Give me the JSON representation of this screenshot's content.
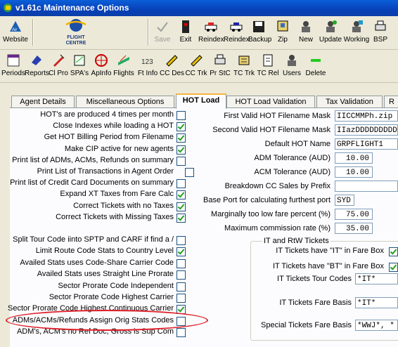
{
  "window": {
    "title": "v1.61c Maintenance Options"
  },
  "toolbar1": [
    {
      "label": "Website",
      "icon": "air-icon"
    },
    {
      "label": "",
      "icon": "flight-centre-logo"
    },
    {
      "label": "Save",
      "icon": "check-icon"
    },
    {
      "label": "Exit",
      "icon": "exit-icon"
    },
    {
      "label": "Reindex",
      "icon": "car-icon"
    },
    {
      "label": "Reindex",
      "icon": "car-icon"
    },
    {
      "label": "Backup",
      "icon": "floppy-icon"
    },
    {
      "label": "Zip",
      "icon": "zip-icon"
    },
    {
      "label": "New",
      "icon": "new-icon"
    },
    {
      "label": "Update",
      "icon": "update-icon"
    },
    {
      "label": "Working",
      "icon": "working-icon"
    },
    {
      "label": "BSP",
      "icon": "printer-icon"
    }
  ],
  "logo": {
    "line1": "FLIGHT",
    "line2": "CENTRE"
  },
  "toolbar2": [
    {
      "label": "Periods"
    },
    {
      "label": "Reports"
    },
    {
      "label": "Cl Pro"
    },
    {
      "label": "SPA's"
    },
    {
      "label": "ApInfo"
    },
    {
      "label": "Flights"
    },
    {
      "label": "Ft Info"
    },
    {
      "label": "CC Des"
    },
    {
      "label": "CC Trk"
    },
    {
      "label": "Pr StC"
    },
    {
      "label": "TC Trk"
    },
    {
      "label": "TC Rel"
    },
    {
      "label": "Users"
    },
    {
      "label": "Delete"
    }
  ],
  "tabs": [
    "Agent Details",
    "Miscellaneous Options",
    "HOT Load",
    "HOT Load Validation",
    "Tax Validation",
    "R"
  ],
  "left_options": [
    {
      "label": "HOT's are produced 4 times per month",
      "checked": false
    },
    {
      "label": "Close Indexes while loading a HOT",
      "checked": true
    },
    {
      "label": "Get HOT Billing Period from Filename",
      "checked": true
    },
    {
      "label": "Make CIP active for new agents",
      "checked": true
    },
    {
      "label": "Print list of ADMs, ACMs, Refunds on summary",
      "checked": false
    },
    {
      "label": "Print List of Transactions in Agent Order",
      "checked": false
    },
    {
      "label": "Print list of Credit Card Documents on summary",
      "checked": false
    },
    {
      "label": "Expand XT Taxes from Fare Calc",
      "checked": true
    },
    {
      "label": "Correct Tickets with no Taxes",
      "checked": true
    },
    {
      "label": "Correct Tickets with Missing Taxes",
      "checked": true
    }
  ],
  "left_options2": [
    {
      "label": "Split Tour Code iinto SPTP and CARF if find a /",
      "checked": false
    },
    {
      "label": "Limit Route Code Stats to Country Level",
      "checked": true
    },
    {
      "label": "Availed Stats uses Code-Share Carrier Code",
      "checked": false
    },
    {
      "label": "Availed Stats uses Straight Line Prorate",
      "checked": false
    },
    {
      "label": "Sector Prorate Code Independent",
      "checked": false
    },
    {
      "label": "Sector Prorate Code Highest Carrier",
      "checked": false
    },
    {
      "label": "Sector Prorate Code Highest Continuous Carrier",
      "checked": true
    },
    {
      "label": "ADMs/ACMs/Refunds Assign Orig Stats Codes",
      "checked": false
    },
    {
      "label": "ADM's, ACM's no Ref Doc, Gross is Sup Com",
      "checked": false
    }
  ],
  "right_fields": [
    {
      "label": "First Valid HOT Filename Mask",
      "value": "IICCMMPh.zip"
    },
    {
      "label": "Second Valid HOT Filename Mask",
      "value": "IIazDDDDDDDDDD"
    },
    {
      "label": "Default HOT Name",
      "value": "GRPFLIGHT1"
    },
    {
      "label": "ADM Tolerance (AUD)",
      "value": "10.00"
    },
    {
      "label": "ACM Tolerance (AUD)",
      "value": "10.00"
    },
    {
      "label": "Breakdown CC Sales by Prefix",
      "value": ""
    },
    {
      "label": "Base Port for calculating furthest port",
      "value": "SYD"
    },
    {
      "label": "Marginally too low fare percent (%)",
      "value": "75.00"
    },
    {
      "label": "Maximum commission rate (%)",
      "value": "35.00"
    }
  ],
  "group": {
    "title": "IT and RtW Tickets",
    "it_fare_box": {
      "label": "IT Tickets have \"IT\" in Fare Box",
      "checked": true
    },
    "bt_fare_box": {
      "label": "IT Tickets have \"BT\" in Fare Box",
      "checked": true
    },
    "tour_codes": {
      "label": "IT Tickets Tour Codes",
      "value": "*IT*"
    },
    "fare_basis": {
      "label": "IT Tickets Fare Basis",
      "value": "*IT*"
    },
    "special_fare_basis": {
      "label": "Special Tickets Fare Basis",
      "value": "*WWJ*, *"
    }
  },
  "colors": {
    "highlight": "#e0202a",
    "title_bar": "#0a4fc8",
    "check": "#21a121"
  }
}
